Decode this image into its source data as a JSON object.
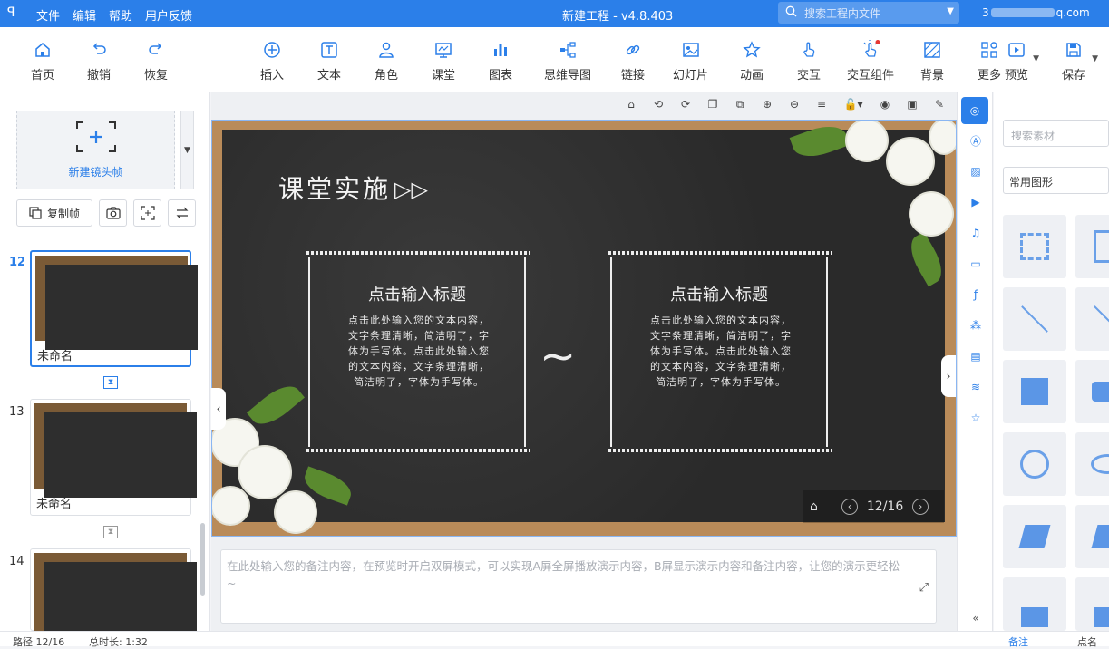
{
  "titlebar": {
    "logo": "ꟼ",
    "menus": [
      "文件",
      "编辑",
      "帮助",
      "用户反馈"
    ],
    "title": "新建工程 - v4.8.403",
    "search_placeholder": "搜索工程内文件",
    "user_prefix": "3",
    "user_suffix": "q.com"
  },
  "toolbar": {
    "items": [
      {
        "label": "首页",
        "icon": "home-icon"
      },
      {
        "label": "撤销",
        "icon": "undo-icon"
      },
      {
        "label": "恢复",
        "icon": "redo-icon"
      },
      {
        "label": "插入",
        "icon": "plus-circle-icon"
      },
      {
        "label": "文本",
        "icon": "text-icon"
      },
      {
        "label": "角色",
        "icon": "person-icon"
      },
      {
        "label": "课堂",
        "icon": "classroom-icon"
      },
      {
        "label": "图表",
        "icon": "chart-icon"
      },
      {
        "label": "思维导图",
        "icon": "mindmap-icon"
      },
      {
        "label": "链接",
        "icon": "link-icon"
      },
      {
        "label": "幻灯片",
        "icon": "slide-icon"
      },
      {
        "label": "动画",
        "icon": "star-icon"
      },
      {
        "label": "交互",
        "icon": "hand-icon"
      },
      {
        "label": "交互组件",
        "icon": "touch-icon"
      },
      {
        "label": "背景",
        "icon": "background-icon"
      },
      {
        "label": "更多",
        "icon": "grid-icon"
      },
      {
        "label": "预览",
        "icon": "play-icon"
      },
      {
        "label": "保存",
        "icon": "save-icon"
      }
    ]
  },
  "left_panel": {
    "new_frame_label": "新建镜头帧",
    "copy_frame_label": "复制帧",
    "slides": [
      {
        "number": "12",
        "name": "未命名"
      },
      {
        "number": "13",
        "name": "未命名"
      },
      {
        "number": "14",
        "name": ""
      }
    ]
  },
  "slide": {
    "title": "课堂实施",
    "cards": [
      {
        "heading": "点击输入标题",
        "body": "点击此处输入您的文本内容，文字条理清晰，简洁明了，字体为手写体。点击此处输入您的文本内容，文字条理清晰，简洁明了，字体为手写体。"
      },
      {
        "heading": "点击输入标题",
        "body": "点击此处输入您的文本内容，文字条理清晰，简洁明了，字体为手写体。点击此处输入您的文本内容，文字条理清晰，简洁明了，字体为手写体。"
      }
    ],
    "page_indicator": "12/16"
  },
  "notes": {
    "placeholder": "在此处输入您的备注内容，在预览时开启双屏模式，可以实现A屏全屏播放演示内容，B屏显示演示内容和备注内容，让您的演示更轻松~"
  },
  "right_panel": {
    "search_placeholder": "搜索素材",
    "category": "常用图形"
  },
  "statusbar": {
    "path": "路径 12/16",
    "duration": "总时长: 1:32",
    "notes_label": "备注",
    "point_label": "点名"
  },
  "colors": {
    "accent": "#2b7fe9",
    "board": "#2a2a2a",
    "frame": "#b98b59"
  }
}
